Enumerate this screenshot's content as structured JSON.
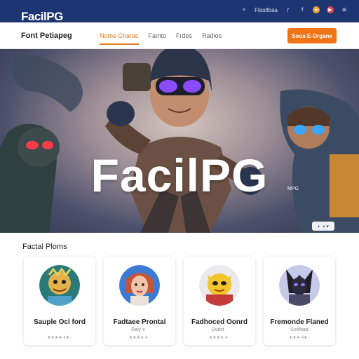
{
  "brand": "FacilPG",
  "topbar": {
    "account_link": "Flautlbaa",
    "icons": [
      "twitter-icon",
      "facebook-icon",
      "instagram-icon",
      "youtube-icon",
      "pinterest-icon",
      "bell-icon"
    ]
  },
  "nav": {
    "site_title": "Font Petiapeg",
    "links": [
      "Nome Charac",
      "Famto",
      "Frdes",
      "Radios"
    ],
    "active_index": 0,
    "cta_label": "Sooa E-Organe"
  },
  "hero": {
    "title": "FacilPG",
    "tag": "MPG",
    "control_label": "◐ ◑ ▾"
  },
  "section": {
    "title": "Factal Ploms"
  },
  "cards": [
    {
      "name": "Sauple Ocl ford",
      "sub": "",
      "meta": "★★★★ 4★ ·",
      "avatar": "monkey-avatar"
    },
    {
      "name": "Fadtaee Prontal",
      "sub": "Raiy x ·",
      "meta": "★★★★ 4 ·",
      "avatar": "girl-avatar"
    },
    {
      "name": "Fadhoced Oonrd",
      "sub": "Svest ·",
      "meta": "★★★★ 4 ·",
      "avatar": "yellow-creature-avatar"
    },
    {
      "name": "Fremonde Flaned",
      "sub": "Scefoaa",
      "meta": "★★★ 4★ ·",
      "avatar": "dark-knight-avatar"
    }
  ],
  "colors": {
    "topbar": "#1d3570",
    "accent": "#f07415",
    "active_nav": "#e87a1e"
  }
}
